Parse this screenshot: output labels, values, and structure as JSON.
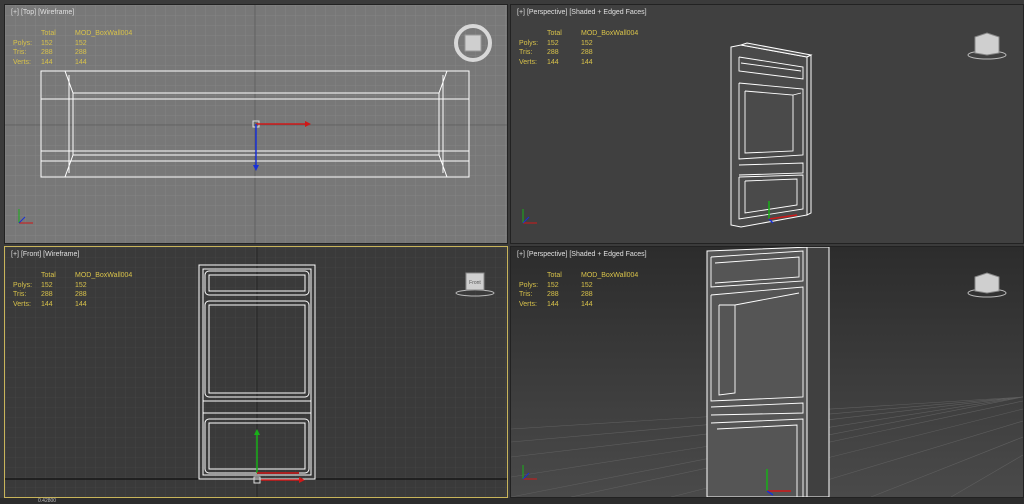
{
  "viewports": {
    "top": {
      "label_plus": "[+]",
      "label_view": "[Top]",
      "label_shading": "[Wireframe]"
    },
    "persp1": {
      "label_plus": "[+]",
      "label_view": "[Perspective]",
      "label_shading": "[Shaded + Edged Faces]"
    },
    "front": {
      "label_plus": "[+]",
      "label_view": "[Front]",
      "label_shading": "[Wireframe]"
    },
    "persp2": {
      "label_plus": "[+]",
      "label_view": "[Perspective]",
      "label_shading": "[Shaded + Edged Faces]"
    }
  },
  "stats": {
    "col_total": "Total",
    "object": "MOD_BoxWall004",
    "polys_label": "Polys:",
    "polys_total": "152",
    "polys_obj": "152",
    "tris_label": "Tris:",
    "tris_total": "288",
    "tris_obj": "288",
    "verts_label": "Verts:",
    "verts_total": "144",
    "verts_obj": "144"
  },
  "viewcube_face": "Front",
  "status": {
    "coord": "0.42800"
  },
  "colors": {
    "active_border": "#c8b45a",
    "wire": "#ffffff",
    "axis_x": "#d01818",
    "axis_y": "#18b018",
    "axis_z": "#1830d8",
    "stats_text": "#d8c24a"
  }
}
